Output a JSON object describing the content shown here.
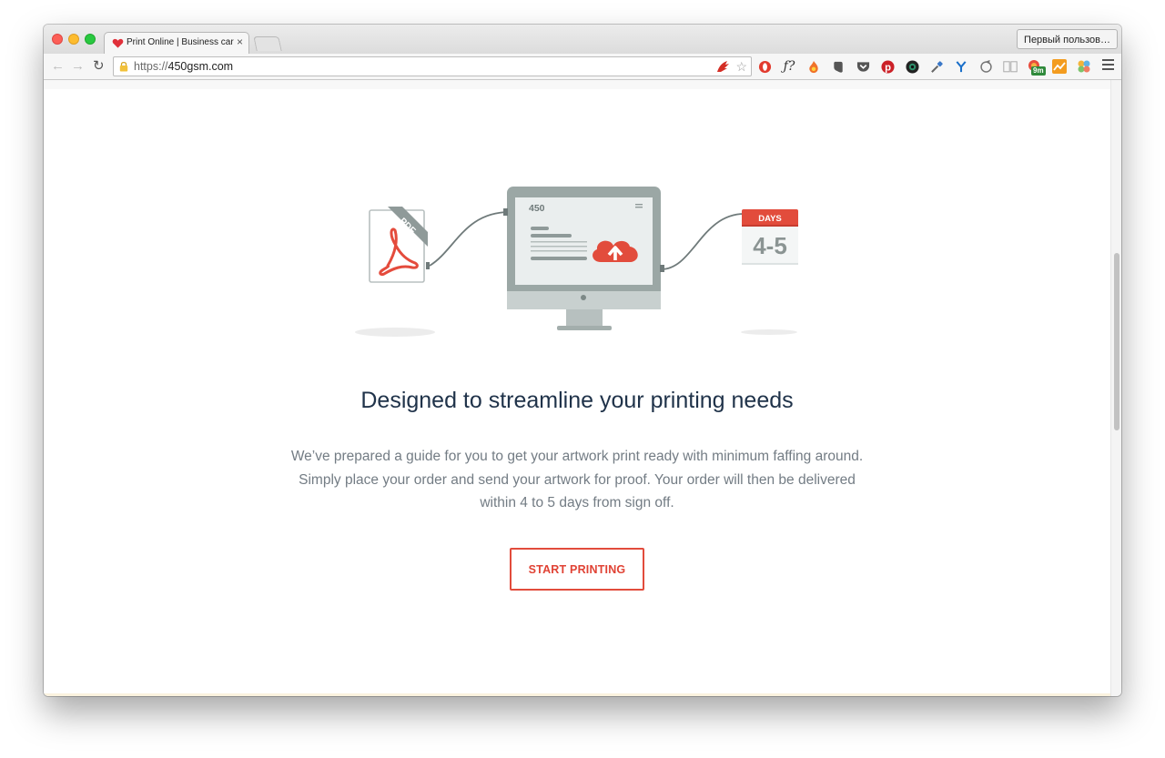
{
  "browser": {
    "tab_title": "Print Online | Business card",
    "tab_close": "×",
    "profile_button": "Первый пользов…",
    "url_protocol": "https://",
    "url_domain": "450gsm.com",
    "nav_back": "←",
    "nav_forward": "→",
    "nav_reload": "↻",
    "bookmark_star": "☆",
    "extension_icons": [
      "opera-icon",
      "formula-icon",
      "fire-icon",
      "evernote-icon",
      "pocket-icon",
      "pinterest-icon",
      "camera-icon",
      "eyedropper-icon",
      "yandex-icon",
      "sync-icon",
      "reader-icon",
      "notification-icon",
      "chart-icon",
      "puzzle-icon"
    ],
    "extension_badge": "9m"
  },
  "illustration": {
    "pdf_ribbon": "PDF",
    "monitor_brand": "450",
    "calendar_header": "DAYS",
    "calendar_range": "4-5"
  },
  "hero": {
    "headline": "Designed to streamline your printing needs",
    "description_line1": "We’ve prepared a guide for you to get your artwork print ready with minimum faffing around.",
    "description_line2": "Simply place your order and send your artwork for proof. Your order will then be delivered",
    "description_line3": "within 4 to 5 days from sign off.",
    "cta_label": "START PRINTING"
  },
  "colors": {
    "accent": "#e24c3c",
    "headline": "#20334a",
    "body_text": "#737c84",
    "monitor_frame": "#9aa5a3"
  }
}
